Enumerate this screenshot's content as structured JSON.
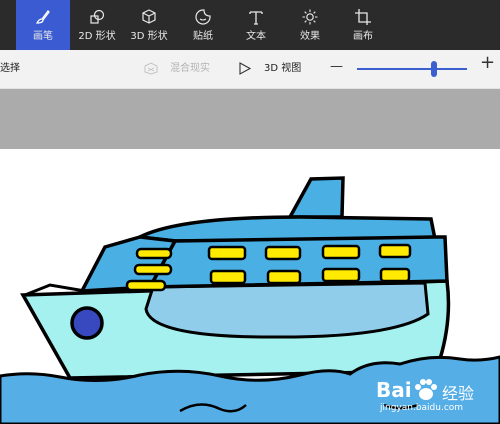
{
  "toolbar": {
    "tools": [
      {
        "label": "画笔",
        "icon": "brush-icon",
        "active": true
      },
      {
        "label": "2D 形状",
        "icon": "shapes-2d-icon"
      },
      {
        "label": "3D 形状",
        "icon": "cube-3d-icon"
      },
      {
        "label": "贴纸",
        "icon": "sticker-icon"
      },
      {
        "label": "文本",
        "icon": "text-icon"
      },
      {
        "label": "效果",
        "icon": "effects-sun-icon"
      },
      {
        "label": "画布",
        "icon": "canvas-crop-icon"
      }
    ],
    "active_color": "#3a5bd1"
  },
  "subbar": {
    "select_label": "选择",
    "mixed_reality_label": "混合现实",
    "view3d_label": "3D 视图",
    "zoom_out_symbol": "—",
    "zoom_in_symbol": "+",
    "zoom_level": 0.7
  },
  "watermark": {
    "brand": "Bai",
    "brand_cn": "经验",
    "url": "jingyan.baidu.com"
  },
  "colors": {
    "hull": "#a4f1f0",
    "cabin": "#4ab0e4",
    "windows": "#ffea00",
    "sea": "#55aee6",
    "porthole": "#3849c0"
  }
}
